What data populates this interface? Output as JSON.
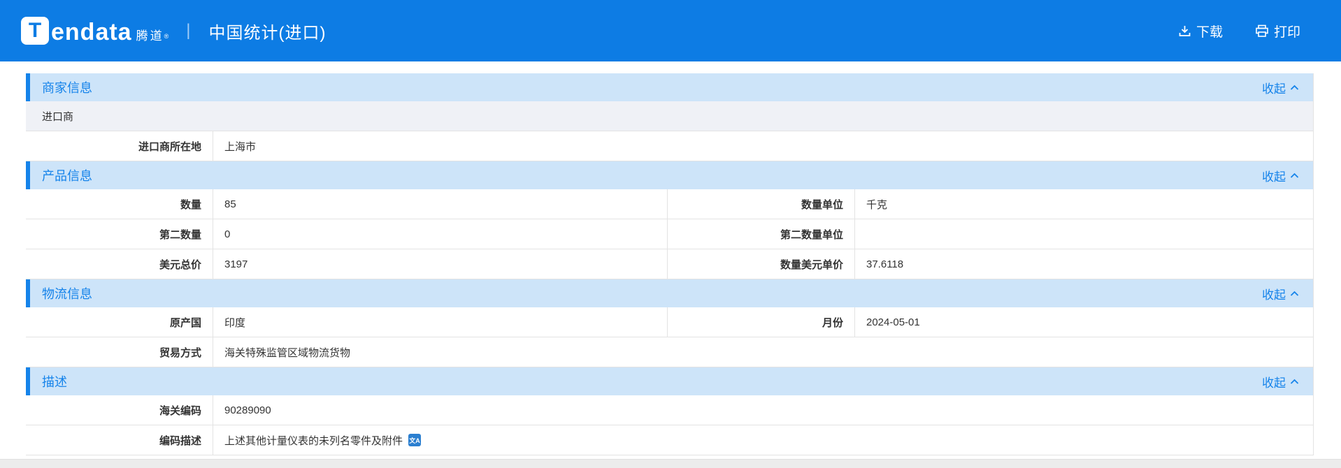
{
  "app": {
    "brand_badge": "T",
    "brand_text": "endata",
    "brand_cn": "腾道",
    "brand_reg": "®",
    "divider": "|",
    "page_title": "中国统计(进口)",
    "download_label": "下载",
    "print_label": "打印"
  },
  "ui": {
    "collapse_label": "收起",
    "translate_icon_glyph": "文A"
  },
  "colors": {
    "appbar_bg": "#0d7ce4",
    "accent_blue": "#1583ea",
    "section_header_bg": "#cde4f9",
    "muted_row_bg": "#eff1f6",
    "row_border": "#e3e3e3"
  },
  "sections": [
    {
      "title": "商家信息",
      "rows": [
        {
          "type": "full",
          "muted": true,
          "text": "进口商"
        },
        {
          "type": "single",
          "label": "进口商所在地",
          "value": "上海市"
        }
      ]
    },
    {
      "title": "产品信息",
      "rows": [
        {
          "type": "double",
          "label1": "数量",
          "value1": "85",
          "label2": "数量单位",
          "value2": "千克"
        },
        {
          "type": "double",
          "label1": "第二数量",
          "value1": "0",
          "label2": "第二数量单位",
          "value2": ""
        },
        {
          "type": "double",
          "label1": "美元总价",
          "value1": "3197",
          "label2": "数量美元单价",
          "value2": "37.6118"
        }
      ]
    },
    {
      "title": "物流信息",
      "rows": [
        {
          "type": "double",
          "label1": "原产国",
          "value1": "印度",
          "label2": "月份",
          "value2": "2024-05-01"
        },
        {
          "type": "single",
          "label": "贸易方式",
          "value": "海关特殊监管区域物流货物"
        }
      ]
    },
    {
      "title": "描述",
      "rows": [
        {
          "type": "single",
          "label": "海关编码",
          "value": "90289090"
        },
        {
          "type": "single",
          "label": "编码描述",
          "value": "上述其他计量仪表的未列名零件及附件",
          "value_icon": "translate-icon"
        }
      ]
    }
  ]
}
